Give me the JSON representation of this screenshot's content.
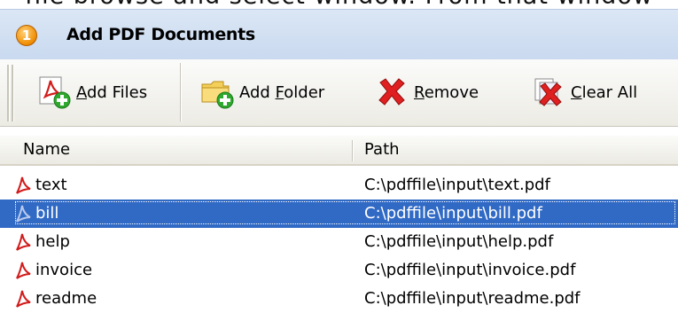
{
  "caption": "file browse and select window. From that window",
  "step": {
    "number": "1",
    "title": "Add PDF Documents"
  },
  "toolbar": {
    "add_files": {
      "pre": "",
      "ul": "A",
      "post": "dd Files"
    },
    "add_folder": {
      "pre": "Add ",
      "ul": "F",
      "post": "older"
    },
    "remove": {
      "pre": "",
      "ul": "R",
      "post": "emove"
    },
    "clear_all": {
      "pre": "",
      "ul": "C",
      "post": "lear All"
    }
  },
  "grid": {
    "columns": {
      "name": "Name",
      "path": "Path"
    },
    "rows": [
      {
        "name": "text",
        "path": "C:\\pdffile\\input\\text.pdf"
      },
      {
        "name": "bill",
        "path": "C:\\pdffile\\input\\bill.pdf"
      },
      {
        "name": "help",
        "path": "C:\\pdffile\\input\\help.pdf"
      },
      {
        "name": "invoice",
        "path": "C:\\pdffile\\input\\invoice.pdf"
      },
      {
        "name": "readme",
        "path": "C:\\pdffile\\input\\readme.pdf"
      }
    ],
    "selected_index": 1
  },
  "colors": {
    "selection": "#316ac5",
    "header_blue": "#c9d9ef",
    "acrobat_red": "#d21b1b",
    "add_green": "#2ea82e",
    "remove_red": "#e02020"
  }
}
